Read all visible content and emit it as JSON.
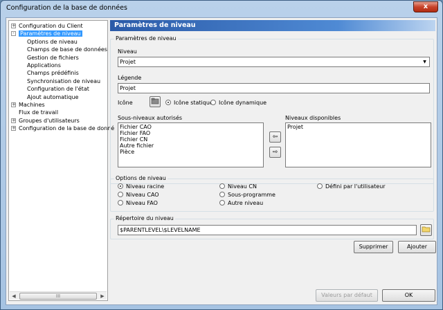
{
  "window": {
    "title": "Configuration de la base de données",
    "close_glyph": "x"
  },
  "tree": {
    "items": [
      {
        "label": "Configuration du Client",
        "level": 0,
        "expander": "+"
      },
      {
        "label": "Paramètres de niveau",
        "level": 0,
        "expander": "-",
        "selected": true
      },
      {
        "label": "Options de niveau",
        "level": 1
      },
      {
        "label": "Champs de base de données",
        "level": 1
      },
      {
        "label": "Gestion de fichiers",
        "level": 1
      },
      {
        "label": "Applications",
        "level": 1
      },
      {
        "label": "Champs prédéfinis",
        "level": 1
      },
      {
        "label": "Synchronisation de niveau",
        "level": 1
      },
      {
        "label": "Configuration de l'état",
        "level": 1
      },
      {
        "label": "Ajout automatique",
        "level": 1
      },
      {
        "label": "Machines",
        "level": 0,
        "expander": "+"
      },
      {
        "label": "Flux de travail",
        "level": 0
      },
      {
        "label": "Groupes d'utilisateurs",
        "level": 0,
        "expander": "+"
      },
      {
        "label": "Configuration de la base de donné",
        "level": 0,
        "expander": "+"
      }
    ],
    "scroll_grip": "III"
  },
  "panel": {
    "header": "Paramètres de niveau",
    "level_params": {
      "legend": "Paramètres de niveau",
      "niveau_label": "Niveau",
      "niveau_value": "Projet",
      "legende_label": "Légende",
      "legende_value": "Projet",
      "icone_label": "Icône",
      "radio_static": "Icône statique",
      "radio_dynamic": "Icône dynamique",
      "sub_levels_label": "Sous-niveaux autorisés",
      "sub_levels": [
        "Fichier CAO",
        "Fichier FAO",
        "Fichier CN",
        "Autre fichier",
        "Pièce"
      ],
      "available_label": "Niveaux disponibles",
      "available": [
        "Projet"
      ]
    },
    "level_options": {
      "legend": "Options de niveau",
      "options": [
        {
          "label": "Niveau racine",
          "checked": true
        },
        {
          "label": "Niveau CAO",
          "checked": false
        },
        {
          "label": "Niveau FAO",
          "checked": false
        },
        {
          "label": "Niveau CN",
          "checked": false
        },
        {
          "label": "Sous-programme",
          "checked": false
        },
        {
          "label": "Autre niveau",
          "checked": false
        },
        {
          "label": "Défini par l'utilisateur",
          "checked": false
        }
      ]
    },
    "directory": {
      "legend": "Répertoire du niveau",
      "value": "$PARENTLEVEL\\$LEVELNAME"
    },
    "buttons": {
      "supprimer": "Supprimer",
      "ajouter": "Ajouter",
      "defaults": "Valeurs par défaut",
      "ok": "OK"
    }
  }
}
